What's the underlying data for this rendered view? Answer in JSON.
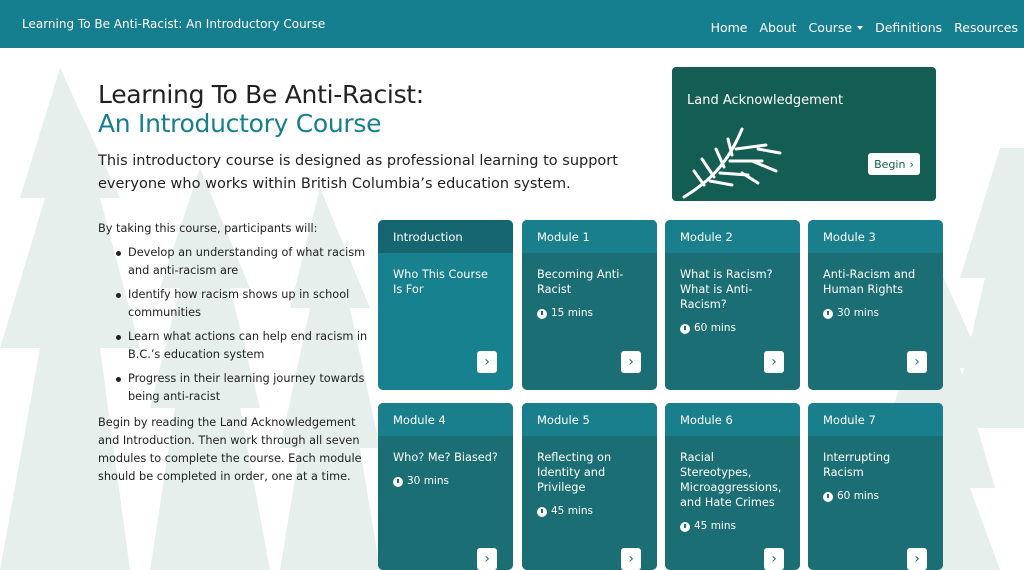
{
  "nav": {
    "brand": "Learning To Be Anti-Racist: An Introductory Course",
    "links": [
      "Home",
      "About",
      "Course",
      "Definitions",
      "Resources"
    ]
  },
  "hero": {
    "title_line1": "Learning To Be Anti-Racist:",
    "title_line2": "An Introductory Course",
    "lead": "This introductory course is designed as professional learning to support everyone who works within British Columbia’s education system."
  },
  "intro": {
    "lead": "By taking this course, participants will:",
    "bullets": [
      "Develop an understanding of what racism and anti-racism are",
      "Identify how racism shows up in school communities",
      "Learn what actions can help end racism in B.C.’s education system",
      "Progress in their learning journey towards being anti-racist"
    ],
    "closing": "Begin by reading the Land Acknowledgement and Introduction. Then work through all seven modules to complete the course. Each module should be completed in order, one at a time."
  },
  "land": {
    "title": "Land Acknowledgement",
    "button": "Begin"
  },
  "cards": [
    {
      "head": "Introduction",
      "title": "Who This Course Is For",
      "duration": ""
    },
    {
      "head": "Module 1",
      "title": "Becoming Anti-Racist",
      "duration": "15 mins"
    },
    {
      "head": "Module 2",
      "title": "What is Racism? What is Anti-Racism?",
      "duration": "60 mins"
    },
    {
      "head": "Module 3",
      "title": "Anti-Racism and Human Rights",
      "duration": "30 mins"
    },
    {
      "head": "Module 4",
      "title": "Who? Me? Biased?",
      "duration": "30 mins"
    },
    {
      "head": "Module 5",
      "title": "Reflecting on Identity and Privilege",
      "duration": "45 mins"
    },
    {
      "head": "Module 6",
      "title": "Racial Stereotypes, Microaggressions, and Hate Crimes",
      "duration": "45 mins"
    },
    {
      "head": "Module 7",
      "title": "Interrupting Racism",
      "duration": "60 mins"
    }
  ],
  "icons": {
    "arrow": "chevron-right-icon",
    "clock": "clock-icon",
    "leaf": "cedar-branch-icon",
    "caret": "caret-down-icon"
  },
  "colors": {
    "nav": "#167f8f",
    "land": "#135d52",
    "card": "#1a6e74",
    "accent": "#167f8f"
  }
}
